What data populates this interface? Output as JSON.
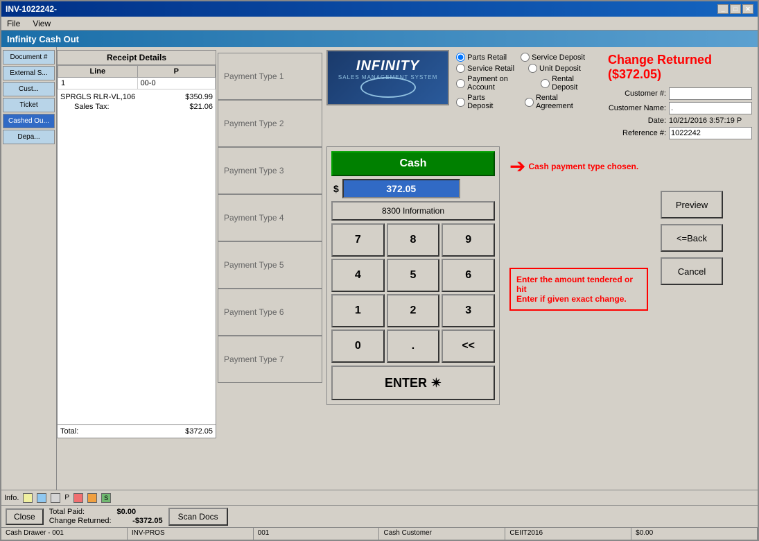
{
  "window": {
    "title": "INV-1022242-",
    "app_title": "Infinity Cash Out"
  },
  "menu": {
    "items": [
      "File",
      "View"
    ]
  },
  "sidebar": {
    "items": [
      {
        "label": "Document #",
        "active": false
      },
      {
        "label": "External S...",
        "active": false
      },
      {
        "label": "Cust...",
        "active": false
      },
      {
        "label": "Ticket",
        "active": false
      },
      {
        "label": "Cashed Ou...",
        "active": false
      },
      {
        "label": "Depa...",
        "active": false
      }
    ]
  },
  "receipt": {
    "header": "Receipt Details",
    "columns": [
      "Line",
      "P"
    ],
    "items": [
      {
        "line": "1",
        "code": "00-0",
        "desc": "SPRGLS RLR-VL,106",
        "amount": "$350.99"
      },
      {
        "label": "Sales Tax:",
        "amount": "$21.06"
      }
    ],
    "total_label": "Total:",
    "total_amount": "$372.05"
  },
  "payment_types": [
    {
      "label": "Payment Type 1",
      "active": false
    },
    {
      "label": "Payment Type 2",
      "active": false
    },
    {
      "label": "Payment Type 3",
      "active": false
    },
    {
      "label": "Payment Type 4",
      "active": false
    },
    {
      "label": "Payment Type 5",
      "active": false
    },
    {
      "label": "Payment Type 6",
      "active": false
    },
    {
      "label": "Payment Type 7",
      "active": false
    }
  ],
  "radio_options": {
    "col1": [
      "Parts Retail",
      "Service Retail",
      "Payment on Account",
      "Parts Deposit"
    ],
    "col2": [
      "Service Deposit",
      "Unit Deposit",
      "Rental Deposit",
      "Rental Agreement"
    ],
    "selected": "Parts Retail"
  },
  "change_returned": {
    "text": "Change Returned ($372.05)"
  },
  "customer": {
    "number_label": "Customer #:",
    "number_value": "",
    "name_label": "Customer Name:",
    "name_value": ".",
    "date_label": "Date:",
    "date_value": "10/21/2016 3:57:19 P",
    "reference_label": "Reference #:",
    "reference_value": "1022242"
  },
  "numpad": {
    "cash_btn": "Cash",
    "amount": "372.05",
    "dollar_sign": "$",
    "info_btn": "8300 Information",
    "buttons": [
      "7",
      "8",
      "9",
      "4",
      "5",
      "6",
      "1",
      "2",
      "3",
      "0",
      ".",
      "<<"
    ],
    "enter_btn": "ENTER"
  },
  "annotations": {
    "cash_annotation": "Cash payment type chosen.",
    "enter_annotation": "Enter the amount tendered or hit\nEnter if given exact change."
  },
  "right_buttons": {
    "preview": "Preview",
    "back": "<=Back",
    "cancel": "Cancel"
  },
  "bottom": {
    "close_btn": "Close",
    "total_paid_label": "Total Paid:",
    "total_paid_value": "$0.00",
    "change_returned_label": "Change Returned:",
    "change_returned_value": "-$372.05",
    "scan_btn": "Scan Docs"
  },
  "statusbar": {
    "items": [
      "Cash Drawer - 001",
      "INV-PROS",
      "001",
      "Cash Customer",
      "CEIIT2016",
      "$0.00"
    ]
  },
  "info_colors": [
    {
      "color": "#f0f0a0",
      "label": ""
    },
    {
      "color": "#90c8f0",
      "label": ""
    },
    {
      "color": "#d4d4d4",
      "label": "P"
    },
    {
      "color": "#f07070",
      "label": ""
    },
    {
      "color": "#f0a040",
      "label": ""
    },
    {
      "color": "#70b870",
      "label": "S"
    }
  ]
}
